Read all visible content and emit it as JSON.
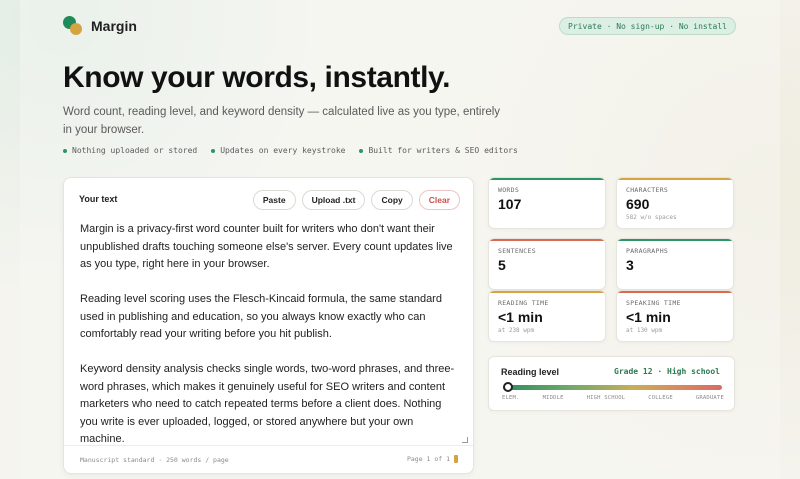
{
  "brand": {
    "name": "Margin"
  },
  "privacy_pill": "Private · No sign-up · No install",
  "hero": {
    "title": "Know your words, instantly.",
    "subtitle": "Word count, reading level, and keyword density — calculated live as you type, entirely in your browser."
  },
  "features": [
    "Nothing uploaded or stored",
    "Updates on every keystroke",
    "Built for writers & SEO editors"
  ],
  "editor": {
    "label": "Your text",
    "buttons": {
      "paste": "Paste",
      "upload": "Upload .txt",
      "copy": "Copy",
      "clear": "Clear"
    },
    "text": "Margin is a privacy-first word counter built for writers who don't want their unpublished drafts touching someone else's server. Every count updates live as you type, right here in your browser.\n\nReading level scoring uses the Flesch-Kincaid formula, the same standard used in publishing and education, so you always know exactly who can comfortably read your writing before you hit publish.\n\nKeyword density analysis checks single words, two-word phrases, and three-word phrases, which makes it genuinely useful for SEO writers and content marketers who need to catch repeated terms before a client does. Nothing you write is ever uploaded, logged, or stored anywhere but your own machine.",
    "footer_left": "Manuscript standard · 250 words / page",
    "footer_right": "Page 1 of 1"
  },
  "stats": {
    "words": {
      "label": "WORDS",
      "value": "107",
      "accent": "#2b9563"
    },
    "characters": {
      "label": "CHARACTERS",
      "value": "690",
      "sub": "582 w/o spaces",
      "accent": "#d4a441"
    },
    "sentences": {
      "label": "SENTENCES",
      "value": "5",
      "accent": "#d86a50"
    },
    "paragraphs": {
      "label": "PARAGRAPHS",
      "value": "3",
      "accent": "#2b9563"
    },
    "reading_time": {
      "label": "READING TIME",
      "value": "<1 min",
      "sub": "at 238 wpm",
      "accent": "#d4a441"
    },
    "speaking_time": {
      "label": "SPEAKING TIME",
      "value": "<1 min",
      "sub": "at 130 wpm",
      "accent": "#d86a50"
    }
  },
  "reading_level": {
    "title": "Reading level",
    "grade": "Grade 12 · High school",
    "position": 0.0,
    "scale": [
      "ELEM.",
      "MIDDLE",
      "HIGH SCHOOL",
      "COLLEGE",
      "GRADUATE"
    ]
  }
}
